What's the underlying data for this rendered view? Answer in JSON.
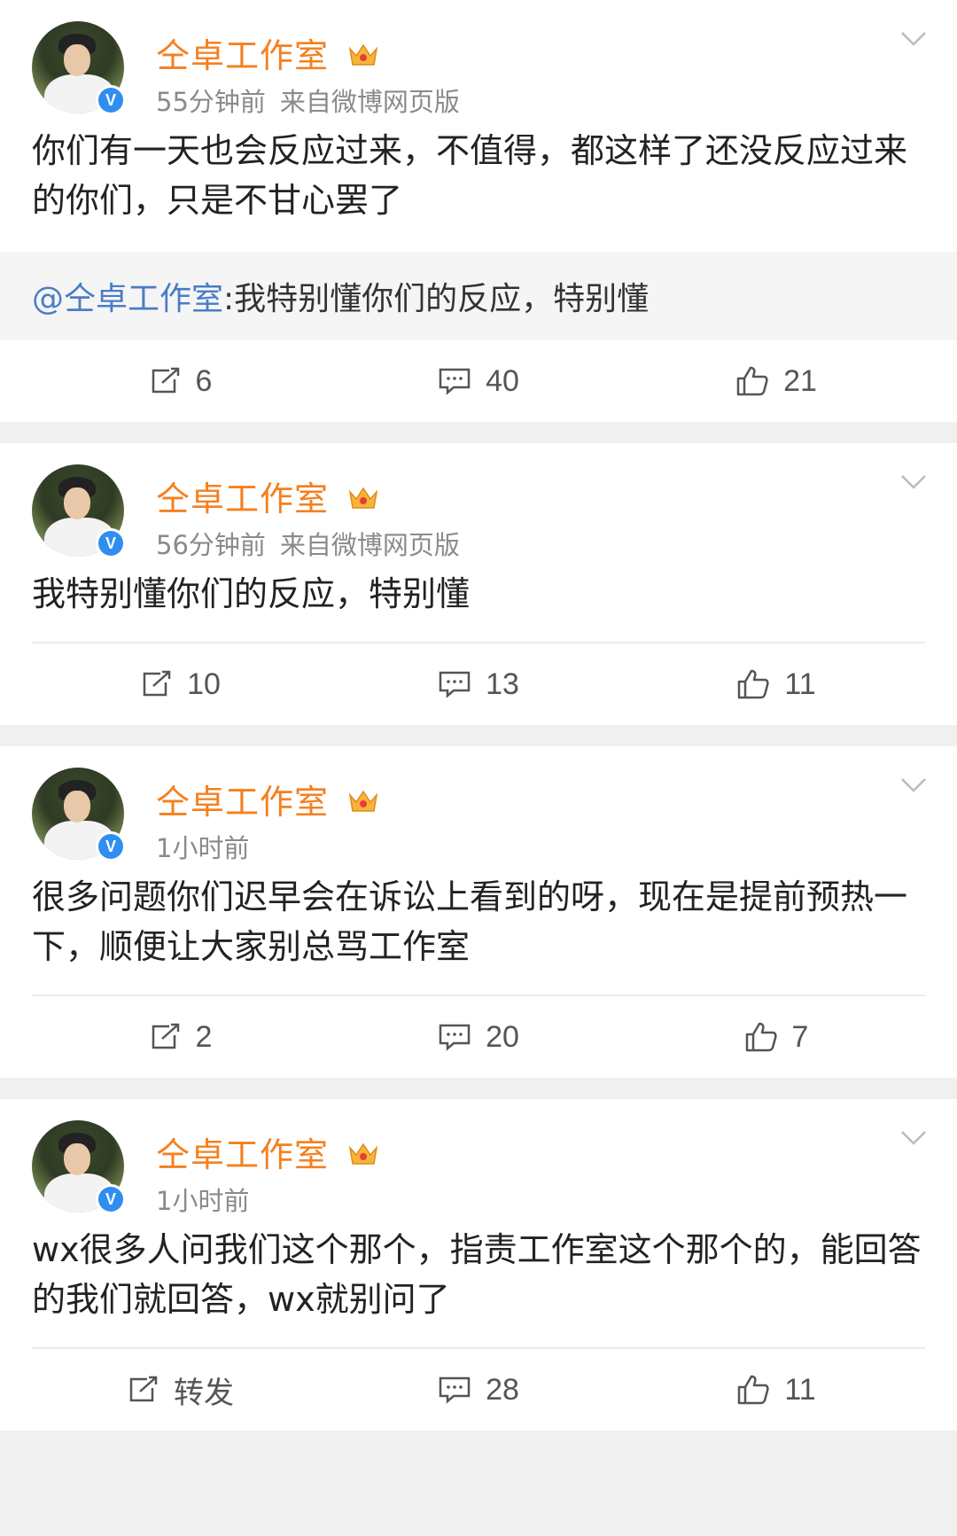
{
  "posts": [
    {
      "author": "仝卓工作室",
      "time": "55分钟前",
      "source": "来自微博网页版",
      "text": "你们有一天也会反应过来，不值得，都这样了还没反应过来的你们，只是不甘心罢了",
      "quote": {
        "mention": "@仝卓工作室",
        "text": ":我特别懂你们的反应，特别懂"
      },
      "repost": "6",
      "comments": "40",
      "likes": "21"
    },
    {
      "author": "仝卓工作室",
      "time": "56分钟前",
      "source": "来自微博网页版",
      "text": "我特别懂你们的反应，特别懂",
      "repost": "10",
      "comments": "13",
      "likes": "11"
    },
    {
      "author": "仝卓工作室",
      "time": "1小时前",
      "source": "",
      "text": "很多问题你们迟早会在诉讼上看到的呀，现在是提前预热一下，顺便让大家别总骂工作室",
      "repost": "2",
      "comments": "20",
      "likes": "7"
    },
    {
      "author": "仝卓工作室",
      "time": "1小时前",
      "source": "",
      "text": "wx很多人问我们这个那个，指责工作室这个那个的，能回答的我们就回答，wx就别问了",
      "repost": "转发",
      "comments": "28",
      "likes": "11"
    }
  ],
  "icons": {
    "verified": "V",
    "name_color": "#f4801f",
    "verified_color": "#2f8ef0",
    "mention_color": "#4a7dc4"
  }
}
